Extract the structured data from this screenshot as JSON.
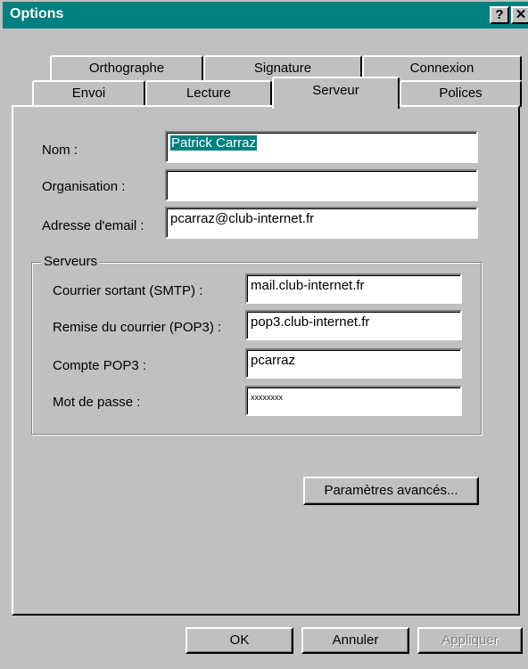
{
  "window": {
    "title": "Options",
    "help_btn": "?",
    "close_btn": "✕"
  },
  "tabs_back": [
    "Orthographe",
    "Signature",
    "Connexion"
  ],
  "tabs_front": [
    "Envoi",
    "Lecture",
    "Serveur",
    "Polices"
  ],
  "active_tab": "Serveur",
  "form": {
    "nom_label": "Nom :",
    "nom_value": "Patrick Carraz",
    "organisation_label": "Organisation :",
    "organisation_value": "",
    "email_label": "Adresse d'email :",
    "email_value": "pcarraz@club-internet.fr"
  },
  "servers": {
    "group_title": "Serveurs",
    "smtp_label": "Courrier sortant (SMTP) :",
    "smtp_value": "mail.club-internet.fr",
    "pop3_label": "Remise du courrier (POP3) :",
    "pop3_value": "pop3.club-internet.fr",
    "account_label": "Compte POP3 :",
    "account_value": "pcarraz",
    "password_label": "Mot de passe :",
    "password_value": "xxxxxxxx"
  },
  "buttons": {
    "advanced": "Paramètres avancés...",
    "ok": "OK",
    "cancel": "Annuler",
    "apply": "Appliquer"
  }
}
